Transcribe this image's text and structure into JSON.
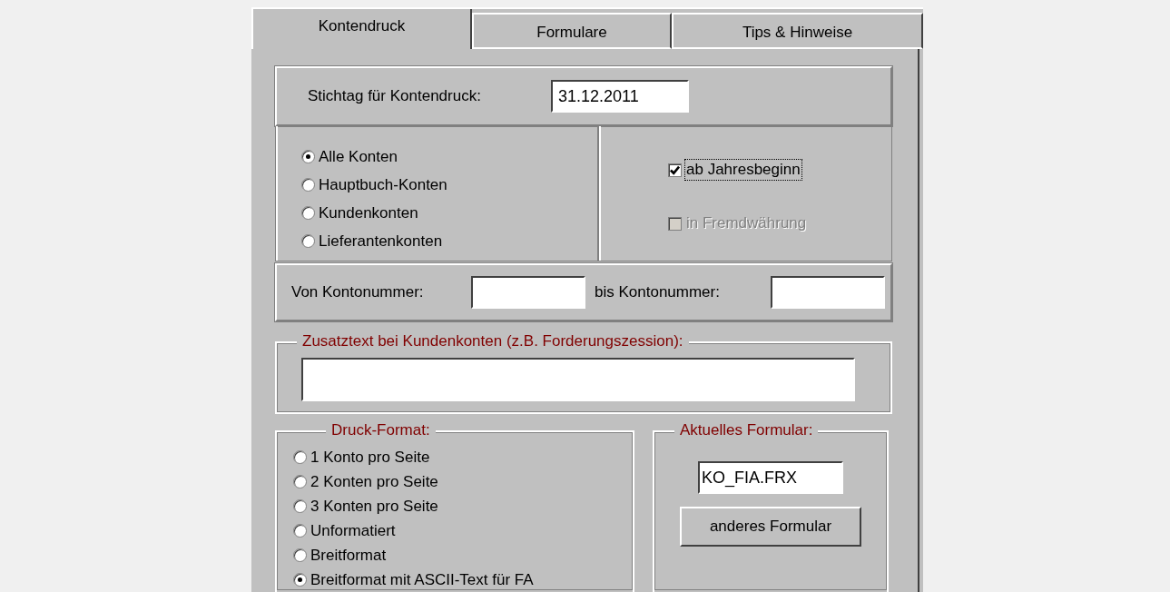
{
  "tabs": [
    {
      "label": "Kontendruck",
      "selected": true
    },
    {
      "label": "Formulare",
      "selected": false
    },
    {
      "label": "Tips & Hinweise",
      "selected": false
    }
  ],
  "stichtag": {
    "label": "Stichtag für Kontendruck:",
    "value": "31.12.2011"
  },
  "account_types": [
    {
      "label": "Alle Konten",
      "selected": true
    },
    {
      "label": "Hauptbuch-Konten",
      "selected": false
    },
    {
      "label": "Kundenkonten",
      "selected": false
    },
    {
      "label": "Lieferantenkonten",
      "selected": false
    }
  ],
  "options": [
    {
      "label": "ab Jahresbeginn",
      "checked": true,
      "disabled": false,
      "focused": true
    },
    {
      "label": "in Fremdwährung",
      "checked": false,
      "disabled": true,
      "focused": false
    }
  ],
  "range": {
    "from_label": "Von Kontonummer:",
    "to_label": "bis Kontonummer:"
  },
  "zusatztext": {
    "title": "Zusatztext bei Kundenkonten (z.B. Forderungszession):"
  },
  "druck_format": {
    "title": "Druck-Format:",
    "options": [
      {
        "label": "1 Konto pro Seite",
        "selected": false
      },
      {
        "label": "2 Konten pro Seite",
        "selected": false
      },
      {
        "label": "3 Konten pro Seite",
        "selected": false
      },
      {
        "label": "Unformatiert",
        "selected": false
      },
      {
        "label": "Breitformat",
        "selected": false
      },
      {
        "label": "Breitformat mit ASCII-Text für FA",
        "selected": true
      }
    ]
  },
  "formular": {
    "title": "Aktuelles Formular:",
    "value": "KO_FIA.FRX",
    "button": "anderes Formular"
  }
}
